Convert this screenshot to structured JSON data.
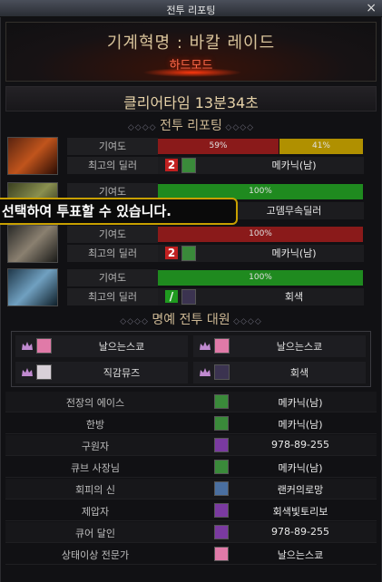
{
  "window": {
    "title": "전투 리포팅",
    "close": "×"
  },
  "header": {
    "raid_title": "기계혁명 : 바칼 레이드",
    "mode": "하드모드"
  },
  "clear_time": "클리어타임  13분34초",
  "battle_section": {
    "title": "전투 리포팅"
  },
  "labels": {
    "contribution": "기여도",
    "best_dealer": "최고의 딜러"
  },
  "bosses": [
    {
      "bars": [
        {
          "label": "59%",
          "value": 59,
          "color": "#8a1a1a"
        },
        {
          "label": "41%",
          "value": 41,
          "color": "#b09000"
        }
      ],
      "rank": "2",
      "rank_color": "#c02020",
      "face": "green",
      "dealer": "메카닉(남)"
    },
    {
      "bars": [
        {
          "label": "100%",
          "value": 100,
          "color": "#1f8a1f"
        }
      ],
      "rank": "",
      "face": "",
      "dealer": "고뎀무속딜러"
    },
    {
      "bars": [
        {
          "label": "100%",
          "value": 100,
          "color": "#8a1a1a"
        }
      ],
      "rank": "2",
      "rank_color": "#c02020",
      "face": "green",
      "dealer": "메카닉(남)"
    },
    {
      "bars": [
        {
          "label": "100%",
          "value": 100,
          "color": "#1f8a1f"
        }
      ],
      "rank": "/",
      "rank_color": "#1f9a1f",
      "face": "dark",
      "dealer": "회색"
    }
  ],
  "tooltip": "선택하여 투표할 수 있습니다.",
  "honor_section": {
    "title": "명예 전투 대원"
  },
  "honor_members": [
    {
      "name": "날으는스쿄",
      "face": "pink"
    },
    {
      "name": "날으는스쿄",
      "face": "pink"
    },
    {
      "name": "직감뮤즈",
      "face": "white"
    },
    {
      "name": "회색",
      "face": "dark"
    }
  ],
  "awards": [
    {
      "title": "전장의 에이스",
      "player": "메카닉(남)",
      "face": "green"
    },
    {
      "title": "한방",
      "player": "메카닉(남)",
      "face": "green"
    },
    {
      "title": "구원자",
      "player": "978-89-255",
      "face": "purple"
    },
    {
      "title": "큐브 사장님",
      "player": "메카닉(남)",
      "face": "green"
    },
    {
      "title": "회피의 신",
      "player": "랜커의로망",
      "face": "blue"
    },
    {
      "title": "제압자",
      "player": "회색빛토리보",
      "face": "purple"
    },
    {
      "title": "큐어 달인",
      "player": "978-89-255",
      "face": "purple"
    },
    {
      "title": "상태이상 전문가",
      "player": "날으는스쿄",
      "face": "pink"
    }
  ],
  "colors": {
    "accent_gold": "#cdb894",
    "hard_mode": "#ff6a4a",
    "tooltip_border": "#c8a000"
  }
}
